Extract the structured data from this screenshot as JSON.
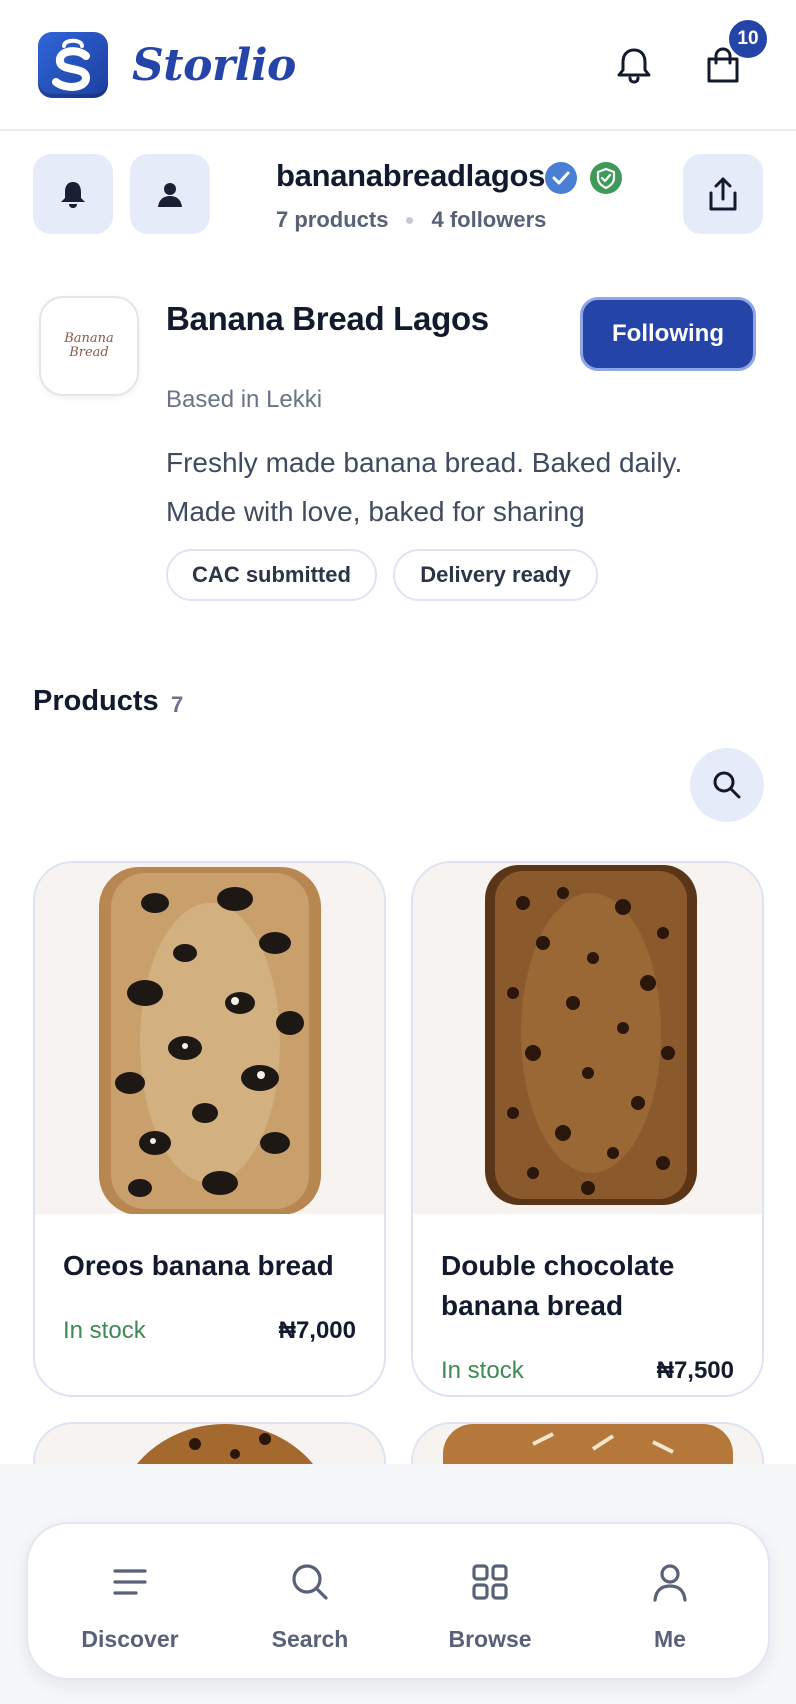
{
  "app": {
    "brand_name": "Storlio",
    "cart_count": "10",
    "brand_color": "#2544a8"
  },
  "store": {
    "handle": "bananabreadlagos",
    "products_stat": "7 products",
    "followers_stat": "4 followers",
    "display_name": "Banana Bread Lagos",
    "follow_label": "Following",
    "location": "Based in Lekki",
    "bio_line1": "Freshly made banana bread. Baked daily.",
    "bio_line2": "Made with love, baked for sharing",
    "chips": [
      "CAC submitted",
      "Delivery ready"
    ],
    "avatar_text_line1": "Banana",
    "avatar_text_line2": "Bread"
  },
  "products": {
    "heading": "Products",
    "count": "7",
    "items": [
      {
        "name": "Oreos banana bread",
        "stock": "In stock",
        "price": "₦7,000",
        "image_icon": "oreo-banana-bread-photo"
      },
      {
        "name": "Double chocolate banana bread",
        "stock": "In stock",
        "price": "₦7,500",
        "image_icon": "double-chocolate-banana-bread-photo"
      }
    ]
  },
  "nav": {
    "items": [
      {
        "label": "Discover",
        "icon": "menu-lines-icon"
      },
      {
        "label": "Search",
        "icon": "search-icon"
      },
      {
        "label": "Browse",
        "icon": "grid-icon"
      },
      {
        "label": "Me",
        "icon": "person-icon"
      }
    ]
  },
  "colors": {
    "accent": "#2544a8",
    "soft_accent_bg": "#e6ebfa",
    "verified_blue": "#4a7fd6",
    "shield_green": "#3f9a5a",
    "stock_green": "#3d8a53"
  }
}
